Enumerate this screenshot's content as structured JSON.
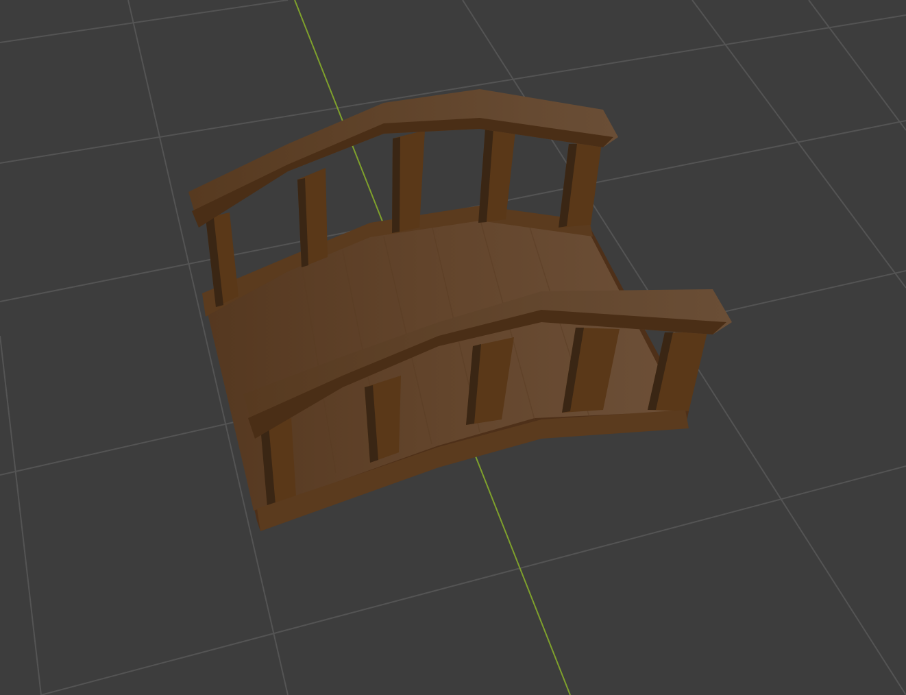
{
  "viewport": {
    "background_color": "#3d3d3d",
    "grid_color": "#545454",
    "axis_y_color": "#7fa12c",
    "object": {
      "name": "bridge",
      "base_color": "#6b4a2e",
      "dark_color": "#4e3019",
      "post_color": "#5a3818",
      "post_shadow_color": "#3a2614"
    }
  }
}
